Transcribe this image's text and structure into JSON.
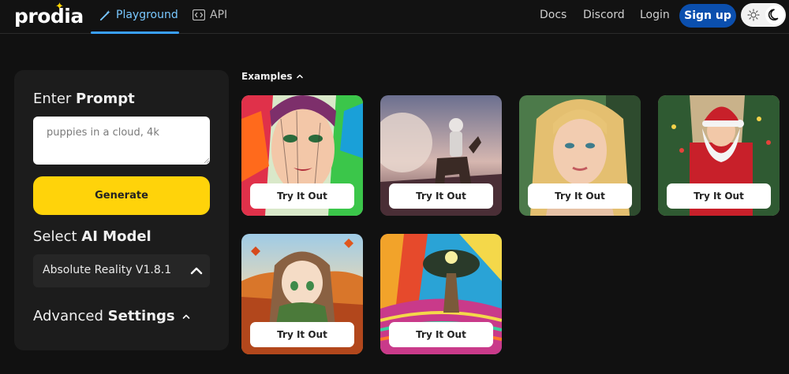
{
  "header": {
    "logo": "prodia",
    "tabs": [
      {
        "label": "Playground",
        "active": true
      },
      {
        "label": "API",
        "active": false
      }
    ],
    "links": {
      "docs": "Docs",
      "discord": "Discord",
      "login": "Login"
    },
    "signup_label": "Sign up",
    "theme": "dark",
    "accent_color": "#3aa0ff"
  },
  "prompt": {
    "label_prefix": "Enter ",
    "label_bold": "Prompt",
    "placeholder": "puppies in a cloud, 4k",
    "value": ""
  },
  "generate_label": "Generate",
  "model": {
    "label_prefix": "Select ",
    "label_bold": "AI Model",
    "selected": "Absolute Reality V1.8.1"
  },
  "advanced": {
    "label_prefix": "Advanced ",
    "label_bold": "Settings"
  },
  "examples": {
    "label": "Examples",
    "items": [
      {
        "button": "Try It Out",
        "icon": "portrait-woman-colorful-splash"
      },
      {
        "button": "Try It Out",
        "icon": "astronaut-on-horse"
      },
      {
        "button": "Try It Out",
        "icon": "portrait-blonde-woman"
      },
      {
        "button": "Try It Out",
        "icon": "santa-claus"
      },
      {
        "button": "Try It Out",
        "icon": "anime-girl-autumn"
      },
      {
        "button": "Try It Out",
        "icon": "psychedelic-tree"
      }
    ]
  }
}
